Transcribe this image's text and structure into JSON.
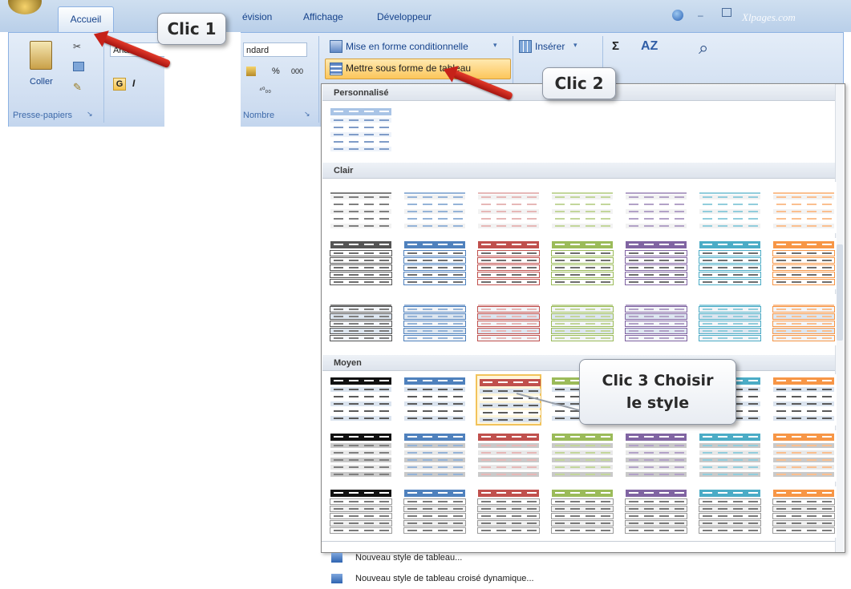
{
  "tabs": {
    "accueil": "Accueil",
    "revision": "évision",
    "affichage": "Affichage",
    "developpeur": "Développeur"
  },
  "watermark": "Xlpages.com",
  "ribbon": {
    "paste_label": "Coller",
    "clipboard_group": "Presse-papiers",
    "font_box": "Arial",
    "bold": "G",
    "italic": "I",
    "number_format": "ndard",
    "percent": "%",
    "thousands": "000",
    "number_group": "Nombre",
    "cond_format": "Mise en forme conditionnelle",
    "format_as_table": "Mettre sous forme de tableau",
    "insert": "Insérer",
    "sigma": "Σ",
    "sort": "AZ"
  },
  "gallery": {
    "section_custom": "Personnalisé",
    "section_light": "Clair",
    "section_medium": "Moyen",
    "new_table_style": "Nouveau style de tableau...",
    "new_pivot_style": "Nouveau style de tableau croisé dynamique...",
    "colors": [
      "#555555",
      "#4f81bd",
      "#c0504d",
      "#9bbb59",
      "#8064a2",
      "#4bacc6",
      "#f79646"
    ],
    "light_colors": [
      "#7f7f7f",
      "#95b3d7",
      "#e6b8b7",
      "#c3d69b",
      "#b2a2c7",
      "#92cddc",
      "#fabf8f"
    ]
  },
  "callouts": {
    "clic1": "Clic 1",
    "clic2": "Clic 2",
    "clic3_line1": "Clic 3 Choisir",
    "clic3_line2": "le style"
  }
}
